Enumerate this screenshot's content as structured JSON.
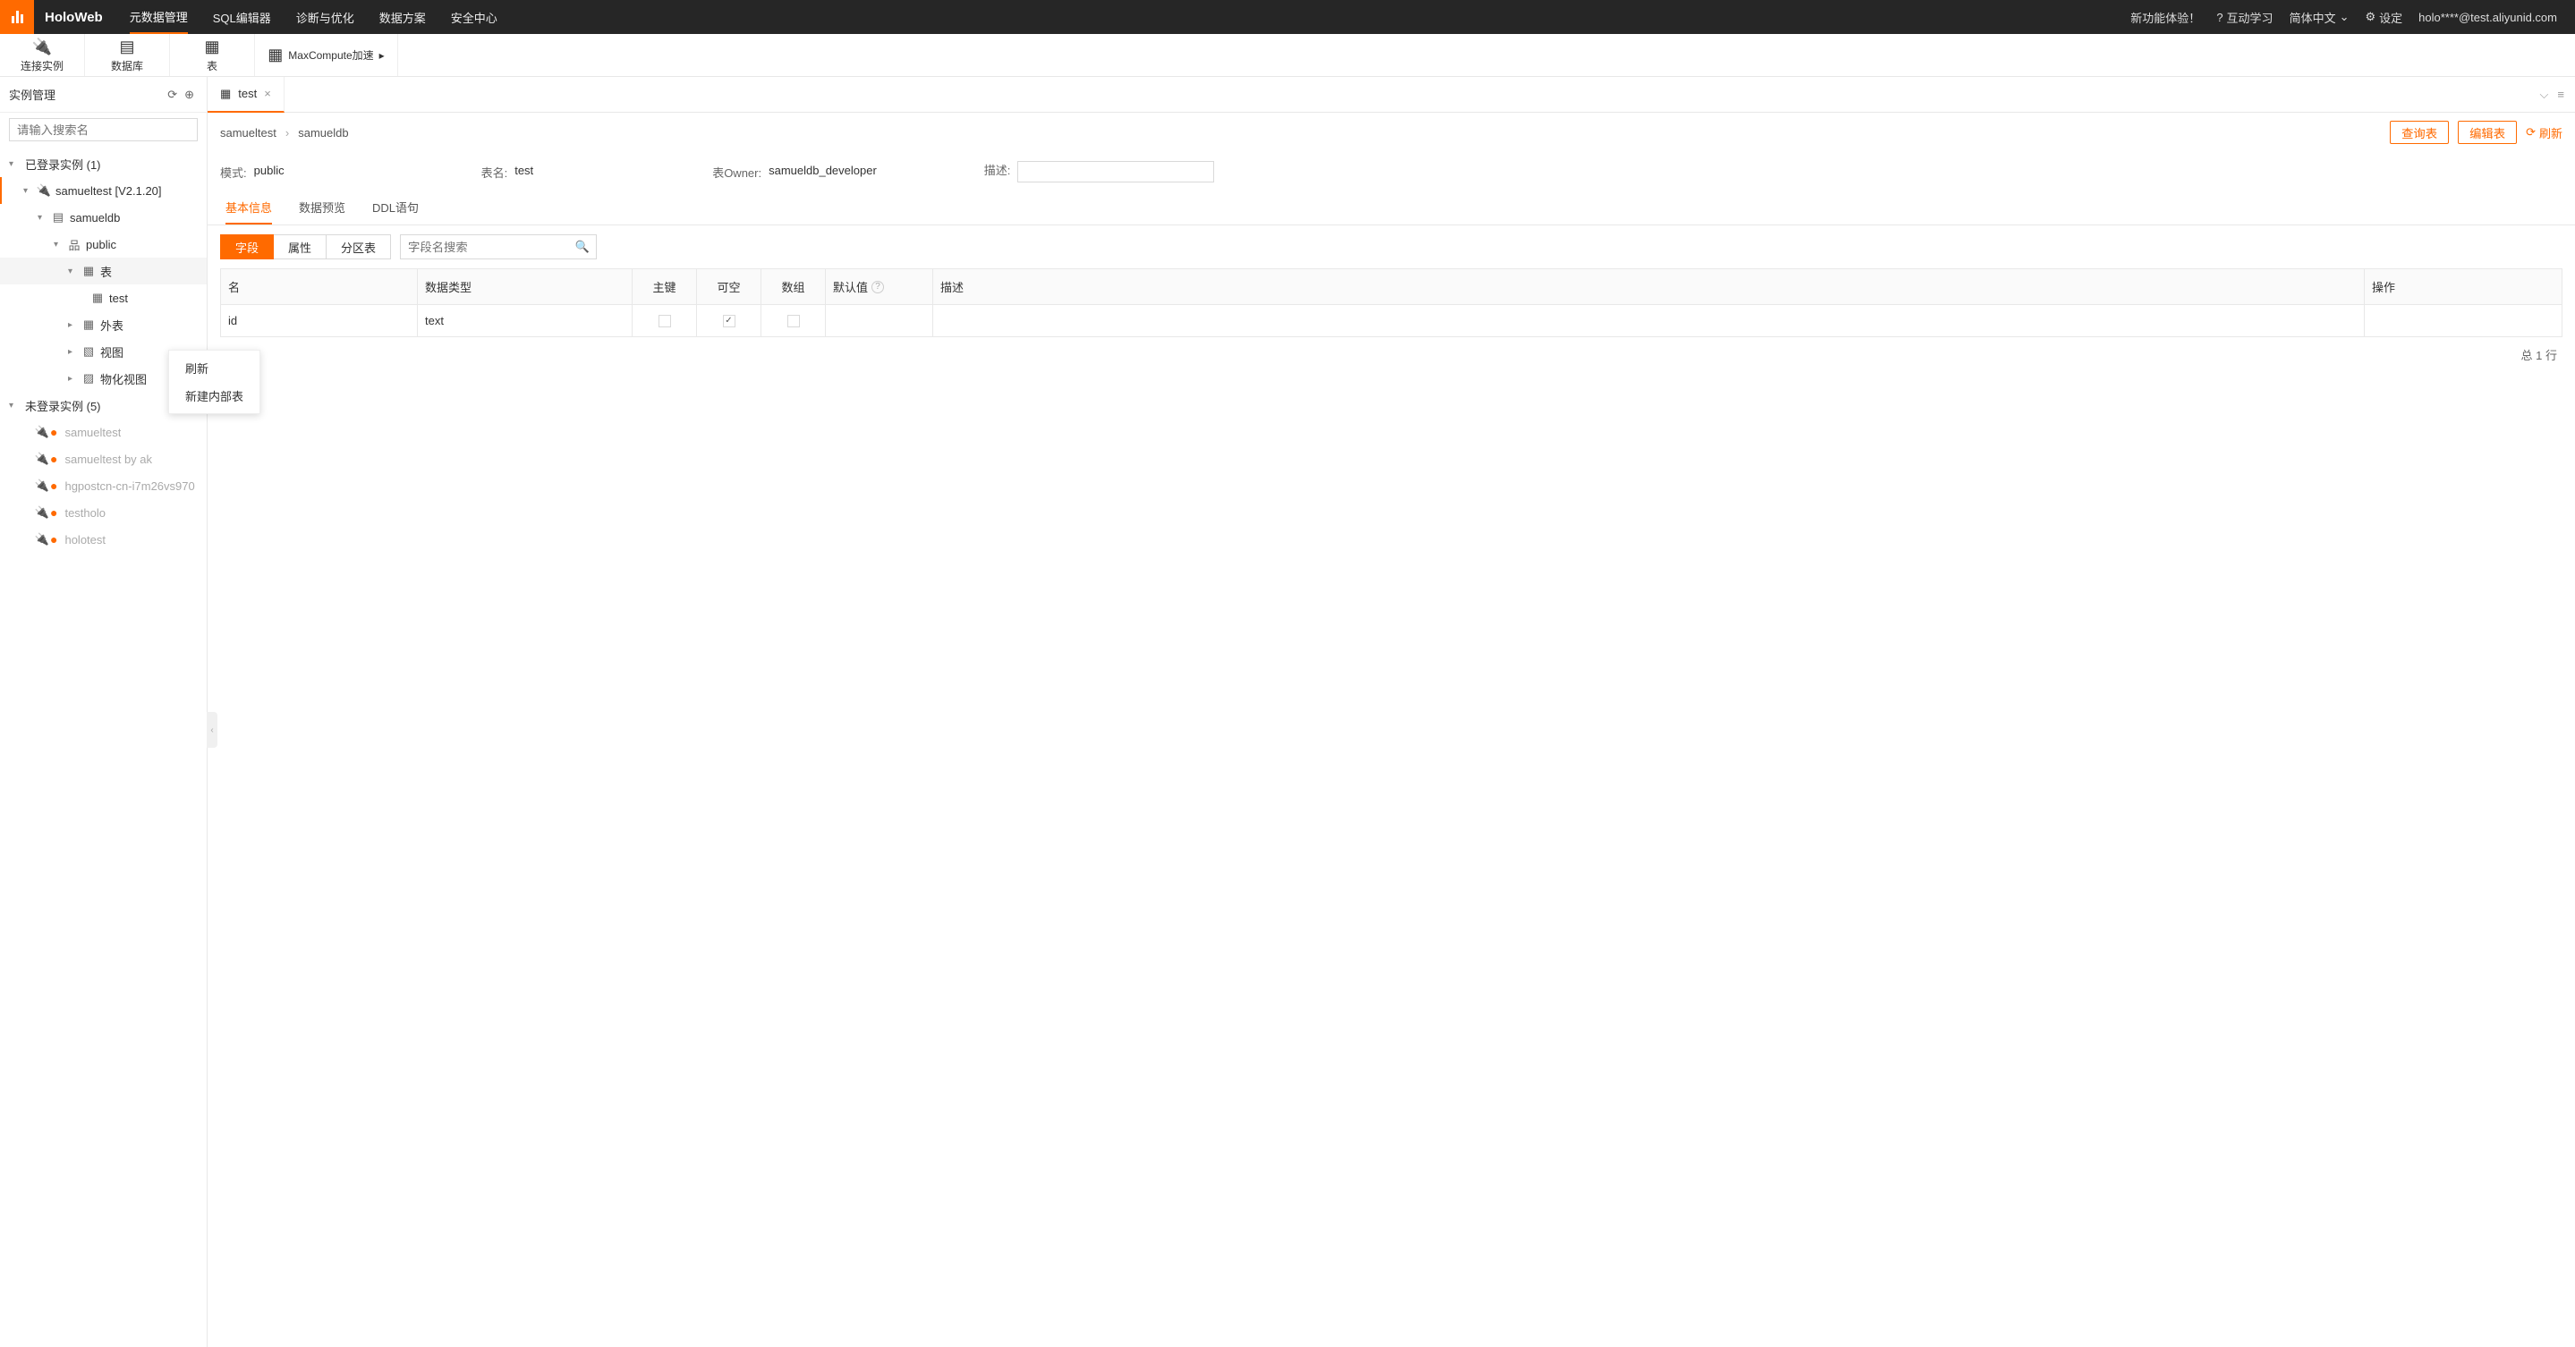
{
  "header": {
    "brand": "HoloWeb",
    "nav": [
      "元数据管理",
      "SQL编辑器",
      "诊断与优化",
      "数据方案",
      "安全中心"
    ],
    "new_feature": "新功能体验！",
    "learn": "互动学习",
    "lang": "简体中文",
    "settings": "设定",
    "user": "holo****@test.aliyunid.com"
  },
  "toolbar": {
    "connect": "连接实例",
    "database": "数据库",
    "table": "表",
    "maxcompute": "MaxCompute加速"
  },
  "sidebar": {
    "title": "实例管理",
    "search_placeholder": "请输入搜索名",
    "logged_in_label": "已登录实例 (1)",
    "instance": "samueltest [V2.1.20]",
    "db": "samueldb",
    "schema": "public",
    "node_table": "表",
    "node_test": "test",
    "node_foreign": "外表",
    "node_view": "视图",
    "node_matview": "物化视图",
    "not_logged_label": "未登录实例 (5)",
    "offline": [
      "samueltest",
      "samueltest by ak",
      "hgpostcn-cn-i7m26vs970",
      "testholo",
      "holotest"
    ],
    "ctx_refresh": "刷新",
    "ctx_new_table": "新建内部表"
  },
  "tabs": {
    "test": "test"
  },
  "crumbs": {
    "a": "samueltest",
    "b": "samueldb"
  },
  "actions": {
    "query": "查询表",
    "edit": "编辑表",
    "refresh": "刷新"
  },
  "meta": {
    "schema_label": "模式:",
    "schema": "public",
    "name_label": "表名:",
    "name": "test",
    "owner_label": "表Owner:",
    "owner": "samueldb_developer",
    "desc_label": "描述:"
  },
  "subtabs": {
    "basic": "基本信息",
    "preview": "数据预览",
    "ddl": "DDL语句"
  },
  "segments": {
    "fields": "字段",
    "attrs": "属性",
    "partition": "分区表"
  },
  "field_search_placeholder": "字段名搜索",
  "cols": {
    "name": "名",
    "type": "数据类型",
    "pk": "主键",
    "null": "可空",
    "arr": "数组",
    "def": "默认值",
    "desc": "描述",
    "op": "操作"
  },
  "rows": [
    {
      "name": "id",
      "type": "text",
      "pk": false,
      "nullable": true,
      "array": false,
      "default": "",
      "desc": ""
    }
  ],
  "footer": "总 1 行"
}
